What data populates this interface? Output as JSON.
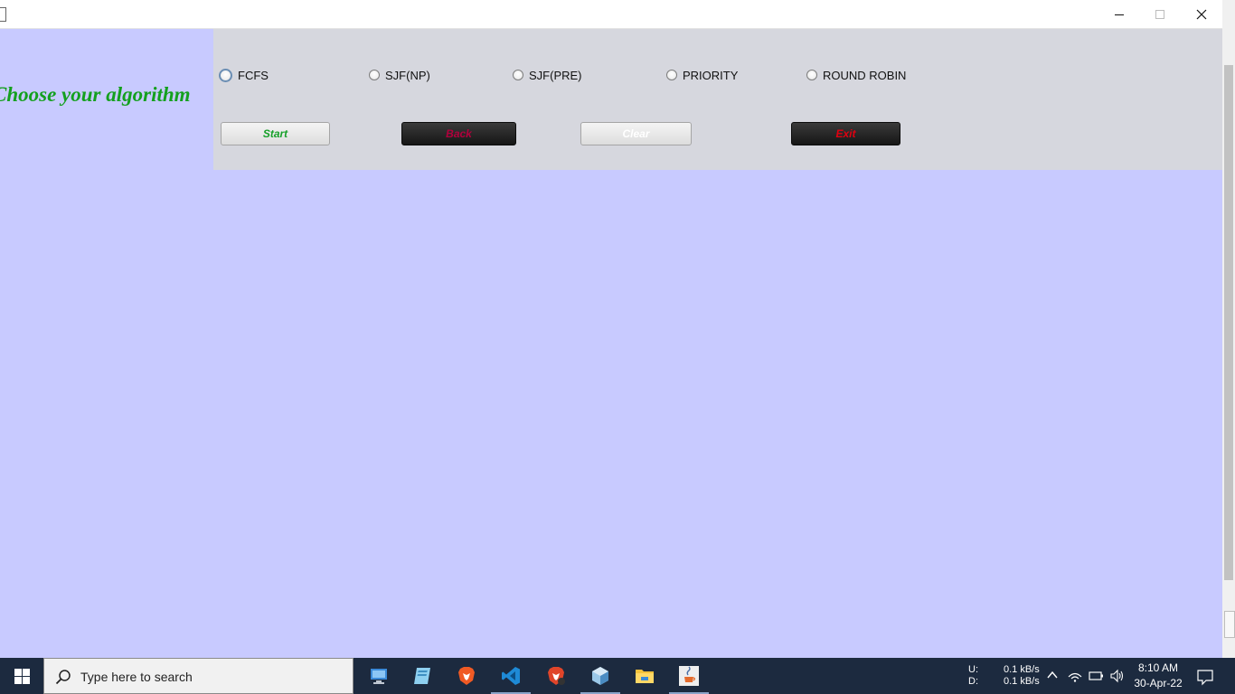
{
  "window": {
    "heading": "Choose your algorithm",
    "radio_options": [
      {
        "label": "FCFS",
        "focused": true
      },
      {
        "label": "SJF(NP)",
        "focused": false
      },
      {
        "label": "SJF(PRE)",
        "focused": false
      },
      {
        "label": "PRIORITY",
        "focused": false
      },
      {
        "label": "ROUND ROBIN",
        "focused": false
      }
    ],
    "buttons": {
      "start": "Start",
      "back": "Back",
      "clear": "Clear",
      "exit": "Exit"
    },
    "colors": {
      "background": "#c8caff",
      "panel": "#d6d7de",
      "heading": "#14a01e",
      "start_text": "#16a029",
      "back_text": "#b2003c",
      "exit_text": "#e00010"
    }
  },
  "taskbar": {
    "search_placeholder": "Type here to search",
    "apps": [
      "this-pc-icon",
      "notepad-icon",
      "brave-icon",
      "vscode-icon",
      "brave-beta-icon",
      "virtualbox-icon",
      "file-explorer-icon",
      "java-icon"
    ],
    "network": {
      "up_label": "U:",
      "down_label": "D:",
      "up_speed": "0.1 kB/s",
      "down_speed": "0.1 kB/s"
    },
    "time": "8:10 AM",
    "date": "30-Apr-22"
  }
}
